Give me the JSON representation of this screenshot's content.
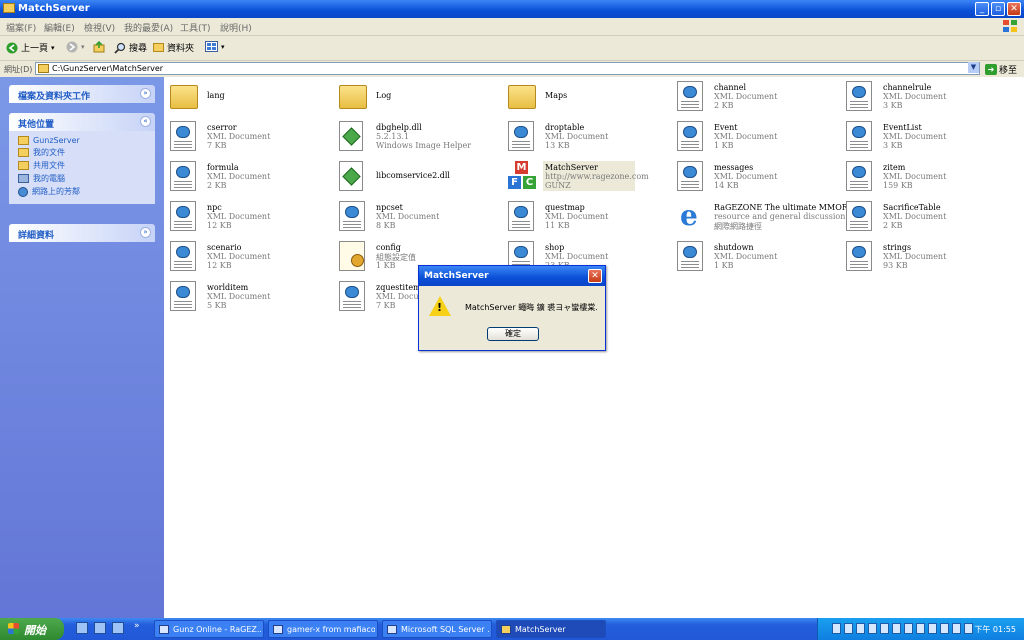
{
  "window": {
    "title": "MatchServer"
  },
  "menu": [
    "檔案(F)",
    "編輯(E)",
    "檢視(V)",
    "我的最愛(A)",
    "工具(T)",
    "說明(H)"
  ],
  "toolbar": {
    "back": "上一頁",
    "search": "搜尋",
    "folders": "資料夾"
  },
  "address": {
    "label": "網址(D)",
    "path": "C:\\GunzServer\\MatchServer",
    "go": "移至"
  },
  "sidebar": {
    "panel1": "檔案及資料夾工作",
    "panel2": "其他位置",
    "places": [
      "GunzServer",
      "我的文件",
      "共用文件",
      "我的電腦",
      "網路上的芳鄰"
    ],
    "panel3": "詳細資料"
  },
  "files": [
    {
      "name": "lang",
      "type": "",
      "size": "",
      "icon": "folder"
    },
    {
      "name": "Log",
      "type": "",
      "size": "",
      "icon": "folder"
    },
    {
      "name": "Maps",
      "type": "",
      "size": "",
      "icon": "folder"
    },
    {
      "name": "channel",
      "type": "XML Document",
      "size": "2 KB",
      "icon": "xml"
    },
    {
      "name": "channelrule",
      "type": "XML Document",
      "size": "3 KB",
      "icon": "xml"
    },
    {
      "name": "cserror",
      "type": "XML Document",
      "size": "7 KB",
      "icon": "xml"
    },
    {
      "name": "dbghelp.dll",
      "type": "5.2.13.1",
      "size": "Windows Image Helper",
      "icon": "dll"
    },
    {
      "name": "droptable",
      "type": "XML Document",
      "size": "13 KB",
      "icon": "xml"
    },
    {
      "name": "Event",
      "type": "XML Document",
      "size": "1 KB",
      "icon": "xml"
    },
    {
      "name": "EventList",
      "type": "XML Document",
      "size": "3 KB",
      "icon": "xml"
    },
    {
      "name": "formula",
      "type": "XML Document",
      "size": "2 KB",
      "icon": "xml"
    },
    {
      "name": "libcomservice2.dll",
      "type": "",
      "size": "",
      "icon": "dll"
    },
    {
      "name": "MatchServer",
      "type": "http://www.ragezone.com",
      "size": "GUNZ",
      "icon": "mfc"
    },
    {
      "name": "messages",
      "type": "XML Document",
      "size": "14 KB",
      "icon": "xml"
    },
    {
      "name": "zitem",
      "type": "XML Document",
      "size": "159 KB",
      "icon": "xml"
    },
    {
      "name": "npc",
      "type": "XML Document",
      "size": "12 KB",
      "icon": "xml"
    },
    {
      "name": "npcset",
      "type": "XML Document",
      "size": "8 KB",
      "icon": "xml"
    },
    {
      "name": "questmap",
      "type": "XML Document",
      "size": "11 KB",
      "icon": "xml"
    },
    {
      "name": "RaGEZONE The ultimate MMORPG",
      "type": "resource and general discussion for...",
      "size": "網際網路捷徑",
      "icon": "ie"
    },
    {
      "name": "SacrificeTable",
      "type": "XML Document",
      "size": "2 KB",
      "icon": "xml"
    },
    {
      "name": "scenario",
      "type": "XML Document",
      "size": "12 KB",
      "icon": "xml"
    },
    {
      "name": "config",
      "type": "組態設定值",
      "size": "1 KB",
      "icon": "cfg"
    },
    {
      "name": "shop",
      "type": "XML Document",
      "size": "23 KB",
      "icon": "xml"
    },
    {
      "name": "shutdown",
      "type": "XML Document",
      "size": "1 KB",
      "icon": "xml"
    },
    {
      "name": "strings",
      "type": "XML Document",
      "size": "93 KB",
      "icon": "xml"
    },
    {
      "name": "worlditem",
      "type": "XML Document",
      "size": "5 KB",
      "icon": "xml"
    },
    {
      "name": "zquestitem",
      "type": "XML Document",
      "size": "7 KB",
      "icon": "xml"
    }
  ],
  "dialog": {
    "title": "MatchServer",
    "message": "MatchServer 蠅晦   鑛 裘ヨャ蠻樓棠.",
    "ok": "確定"
  },
  "taskbar": {
    "start": "開始",
    "tasks": [
      "Gunz Online - RaGEZ...",
      "gamer-x from mafiaco...",
      "Microsoft SQL Server ...",
      "MatchServer"
    ],
    "clock": "下午 01:55"
  }
}
